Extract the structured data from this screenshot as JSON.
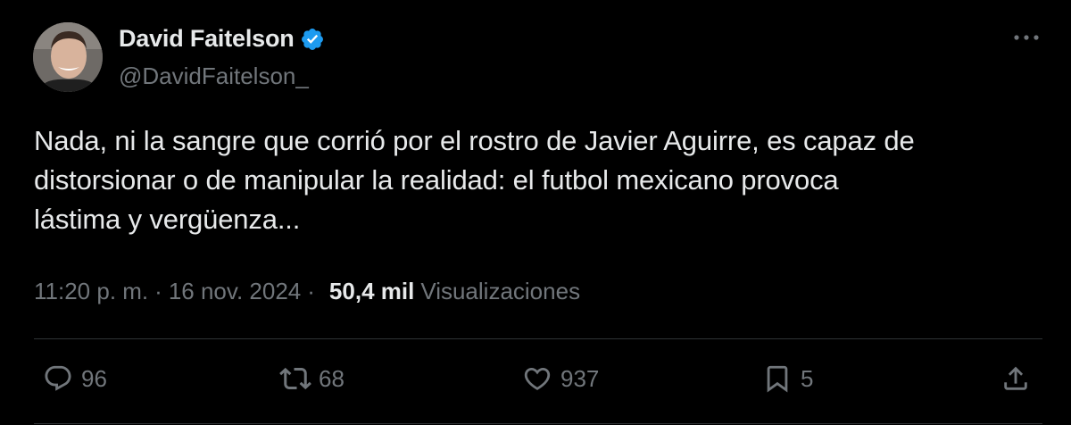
{
  "author": {
    "display_name": "David Faitelson",
    "handle": "@DavidFaitelson_",
    "verified_icon": "verified-badge-icon",
    "verified_color": "#1d9bf0"
  },
  "tweet": {
    "text_lines": [
      "Nada, ni la sangre que corrió por el rostro de Javier Aguirre, es capaz de",
      "distorsionar o de manipular la realidad: el futbol mexicano provoca",
      "lástima y vergüenza..."
    ]
  },
  "meta": {
    "time": "11:20 p. m.",
    "separator": "·",
    "date": "16 nov. 2024",
    "views_count": "50,4 mil",
    "views_label": "Visualizaciones"
  },
  "actions": {
    "replies": {
      "icon": "reply-icon",
      "count": "96"
    },
    "reposts": {
      "icon": "repost-icon",
      "count": "68"
    },
    "likes": {
      "icon": "heart-icon",
      "count": "937"
    },
    "bookmarks": {
      "icon": "bookmark-icon",
      "count": "5"
    },
    "share": {
      "icon": "share-icon"
    }
  },
  "colors": {
    "background": "#000000",
    "text_primary": "#e7e9ea",
    "text_secondary": "#71767b",
    "divider": "#2f3336"
  }
}
